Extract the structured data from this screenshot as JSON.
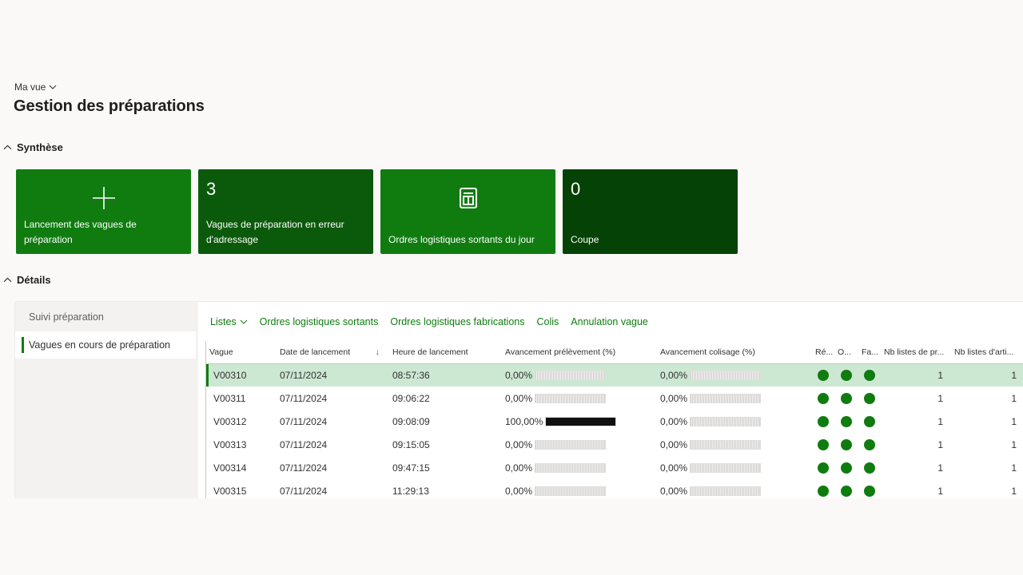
{
  "header": {
    "view_label": "Ma vue",
    "title": "Gestion des préparations"
  },
  "sections": {
    "synthese": "Synthèse",
    "details": "Détails"
  },
  "tiles": [
    {
      "label": "Lancement des vagues de préparation",
      "icon": "plus-icon",
      "count": null
    },
    {
      "label": "Vagues de préparation en erreur d'adressage",
      "count": "3"
    },
    {
      "label": "Ordres logistiques sortants du jour",
      "icon": "form-icon",
      "count": null
    },
    {
      "label": "Coupe",
      "count": "0"
    }
  ],
  "nav": {
    "items": [
      {
        "label": "Suivi préparation"
      },
      {
        "label": "Vagues en cours de préparation"
      }
    ]
  },
  "actions": {
    "listes": "Listes",
    "ordres_sortants": "Ordres logistiques sortants",
    "ordres_fabrications": "Ordres logistiques fabrications",
    "colis": "Colis",
    "annulation": "Annulation vague"
  },
  "table": {
    "columns": {
      "vague": "Vague",
      "date": "Date de lancement",
      "heure": "Heure de lancement",
      "prelevement": "Avancement prélèvement (%)",
      "colisage": "Avancement colisage (%)",
      "re": "Ré...",
      "o": "O...",
      "fa": "Fa...",
      "nb_listes": "Nb listes de pr...",
      "nb_articles": "Nb listes d'arti..."
    },
    "rows": [
      {
        "vague": "V00310",
        "date": "07/11/2024",
        "heure": "08:57:36",
        "prel": "0,00%",
        "prel_value": 0,
        "col": "0,00%",
        "col_value": 0,
        "nb_listes": "1",
        "nb_articles": "1"
      },
      {
        "vague": "V00311",
        "date": "07/11/2024",
        "heure": "09:06:22",
        "prel": "0,00%",
        "prel_value": 0,
        "col": "0,00%",
        "col_value": 0,
        "nb_listes": "1",
        "nb_articles": "1"
      },
      {
        "vague": "V00312",
        "date": "07/11/2024",
        "heure": "09:08:09",
        "prel": "100,00%",
        "prel_value": 100,
        "col": "0,00%",
        "col_value": 0,
        "nb_listes": "1",
        "nb_articles": "1"
      },
      {
        "vague": "V00313",
        "date": "07/11/2024",
        "heure": "09:15:05",
        "prel": "0,00%",
        "prel_value": 0,
        "col": "0,00%",
        "col_value": 0,
        "nb_listes": "1",
        "nb_articles": "1"
      },
      {
        "vague": "V00314",
        "date": "07/11/2024",
        "heure": "09:47:15",
        "prel": "0,00%",
        "prel_value": 0,
        "col": "0,00%",
        "col_value": 0,
        "nb_listes": "1",
        "nb_articles": "1"
      },
      {
        "vague": "V00315",
        "date": "07/11/2024",
        "heure": "11:29:13",
        "prel": "0,00%",
        "prel_value": 0,
        "col": "0,00%",
        "col_value": 0,
        "nb_listes": "1",
        "nb_articles": "1"
      }
    ]
  },
  "colors": {
    "accent": "#107c10",
    "tile_dark": "#0b5a0b",
    "tile_darker": "#054205",
    "selected_row": "#cce8d2",
    "status_dot": "#107c10"
  }
}
